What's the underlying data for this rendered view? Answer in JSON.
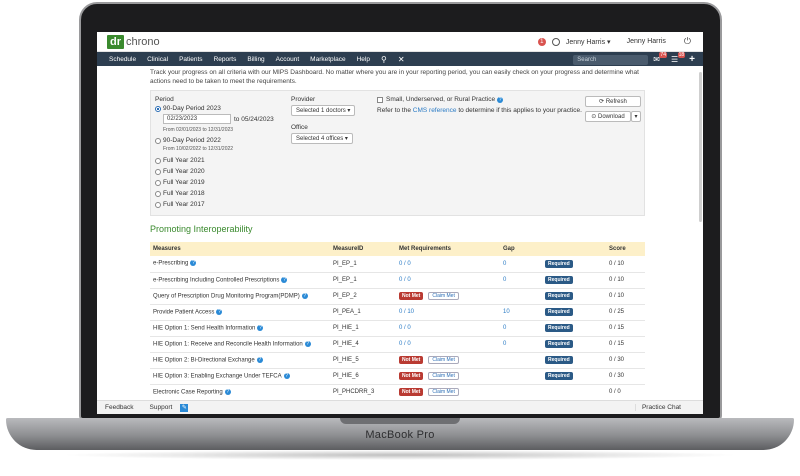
{
  "device": {
    "label": "MacBook Pro"
  },
  "topbar": {
    "logo_dr": "dr",
    "logo_name": "chrono",
    "user_primary": "Jenny Harris",
    "user_secondary": "Jenny Harris",
    "alert_count": "1"
  },
  "nav": {
    "items": [
      "Schedule",
      "Clinical",
      "Patients",
      "Reports",
      "Billing",
      "Account",
      "Marketplace",
      "Help"
    ],
    "search_placeholder": "Search",
    "messages_count": "74",
    "tasks_count": "18"
  },
  "intro": "Track your progress on all criteria with our MIPS Dashboard. No matter where you are in your reporting period, you can easily check on your progress and determine what actions need to be taken to meet the requirements.",
  "filters": {
    "period_label": "Period",
    "period_options": [
      {
        "label": "90-Day Period 2023",
        "selected": true
      },
      {
        "label": "90-Day Period 2022",
        "selected": false
      },
      {
        "label": "Full Year 2021",
        "selected": false
      },
      {
        "label": "Full Year 2020",
        "selected": false
      },
      {
        "label": "Full Year 2019",
        "selected": false
      },
      {
        "label": "Full Year 2018",
        "selected": false
      },
      {
        "label": "Full Year 2017",
        "selected": false
      }
    ],
    "start_date": "02/23/2023",
    "end_date_text": "to 05/24/2023",
    "range_2023": "From 02/01/2023 to 12/31/2023",
    "range_2022": "From 10/02/2022 to 12/31/2022",
    "provider_label": "Provider",
    "provider_value": "Selected 1 doctors",
    "office_label": "Office",
    "office_value": "Selected 4 offices",
    "rural_label": "Small, Underserved, or Rural Practice",
    "cms_prefix": "Refer to the",
    "cms_link": "CMS reference",
    "cms_suffix": "to determine if this applies to your practice.",
    "refresh_label": "Refresh",
    "download_label": "Download"
  },
  "section_title": "Promoting Interoperability",
  "table": {
    "headers": [
      "Measures",
      "MeasureID",
      "Met Requirements",
      "Gap",
      "",
      "Score"
    ],
    "rows": [
      {
        "measure": "e-Prescribing",
        "help": true,
        "id": "PI_EP_1",
        "met": "0 / 0",
        "met_type": "value",
        "gap": "0",
        "required": true,
        "score": "0 / 10"
      },
      {
        "measure": "e-Prescribing Including Controlled Prescriptions",
        "help": true,
        "id": "PI_EP_1",
        "met": "0 / 0",
        "met_type": "value",
        "gap": "0",
        "required": true,
        "score": "0 / 10"
      },
      {
        "measure": "Query of Prescription Drug Monitoring Program(PDMP)",
        "help": true,
        "id": "PI_EP_2",
        "met": "Not Met",
        "met_type": "claim",
        "gap": "",
        "required": true,
        "score": "0 / 10"
      },
      {
        "measure": "Provide Patient Access",
        "help": true,
        "id": "PI_PEA_1",
        "met": "0 / 10",
        "met_type": "value",
        "gap": "10",
        "required": true,
        "score": "0 / 25"
      },
      {
        "measure": "HIE Option 1: Send Health Information",
        "help": true,
        "id": "PI_HIE_1",
        "met": "0 / 0",
        "met_type": "value",
        "gap": "0",
        "required": true,
        "score": "0 / 15"
      },
      {
        "measure": "HIE Option 1: Receive and Reconcile Health Information",
        "help": true,
        "id": "PI_HIE_4",
        "met": "0 / 0",
        "met_type": "value",
        "gap": "0",
        "required": true,
        "score": "0 / 15"
      },
      {
        "measure": "HIE Option 2: Bi-Directional Exchange",
        "help": true,
        "id": "PI_HIE_5",
        "met": "Not Met",
        "met_type": "claim",
        "gap": "",
        "required": true,
        "score": "0 / 30"
      },
      {
        "measure": "HIE Option 3: Enabling Exchange Under TEFCA",
        "help": true,
        "id": "PI_HIE_6",
        "met": "Not Met",
        "met_type": "claim",
        "gap": "",
        "required": true,
        "score": "0 / 30"
      },
      {
        "measure": "Electronic Case Reporting",
        "help": true,
        "id": "PI_PHCDRR_3",
        "met": "Not Met",
        "met_type": "claim",
        "gap": "",
        "required": false,
        "score": "0 / 0"
      }
    ],
    "required_label": "Required",
    "claim_label": "Claim Met"
  },
  "footer": {
    "feedback": "Feedback",
    "support": "Support",
    "chat": "Practice Chat"
  },
  "colors": {
    "nav_bg": "#2d3e50",
    "brand_green": "#3a8a2e",
    "required_blue": "#2b5a86",
    "not_met_red": "#b93a32",
    "header_yellow": "#fdf0c9"
  }
}
